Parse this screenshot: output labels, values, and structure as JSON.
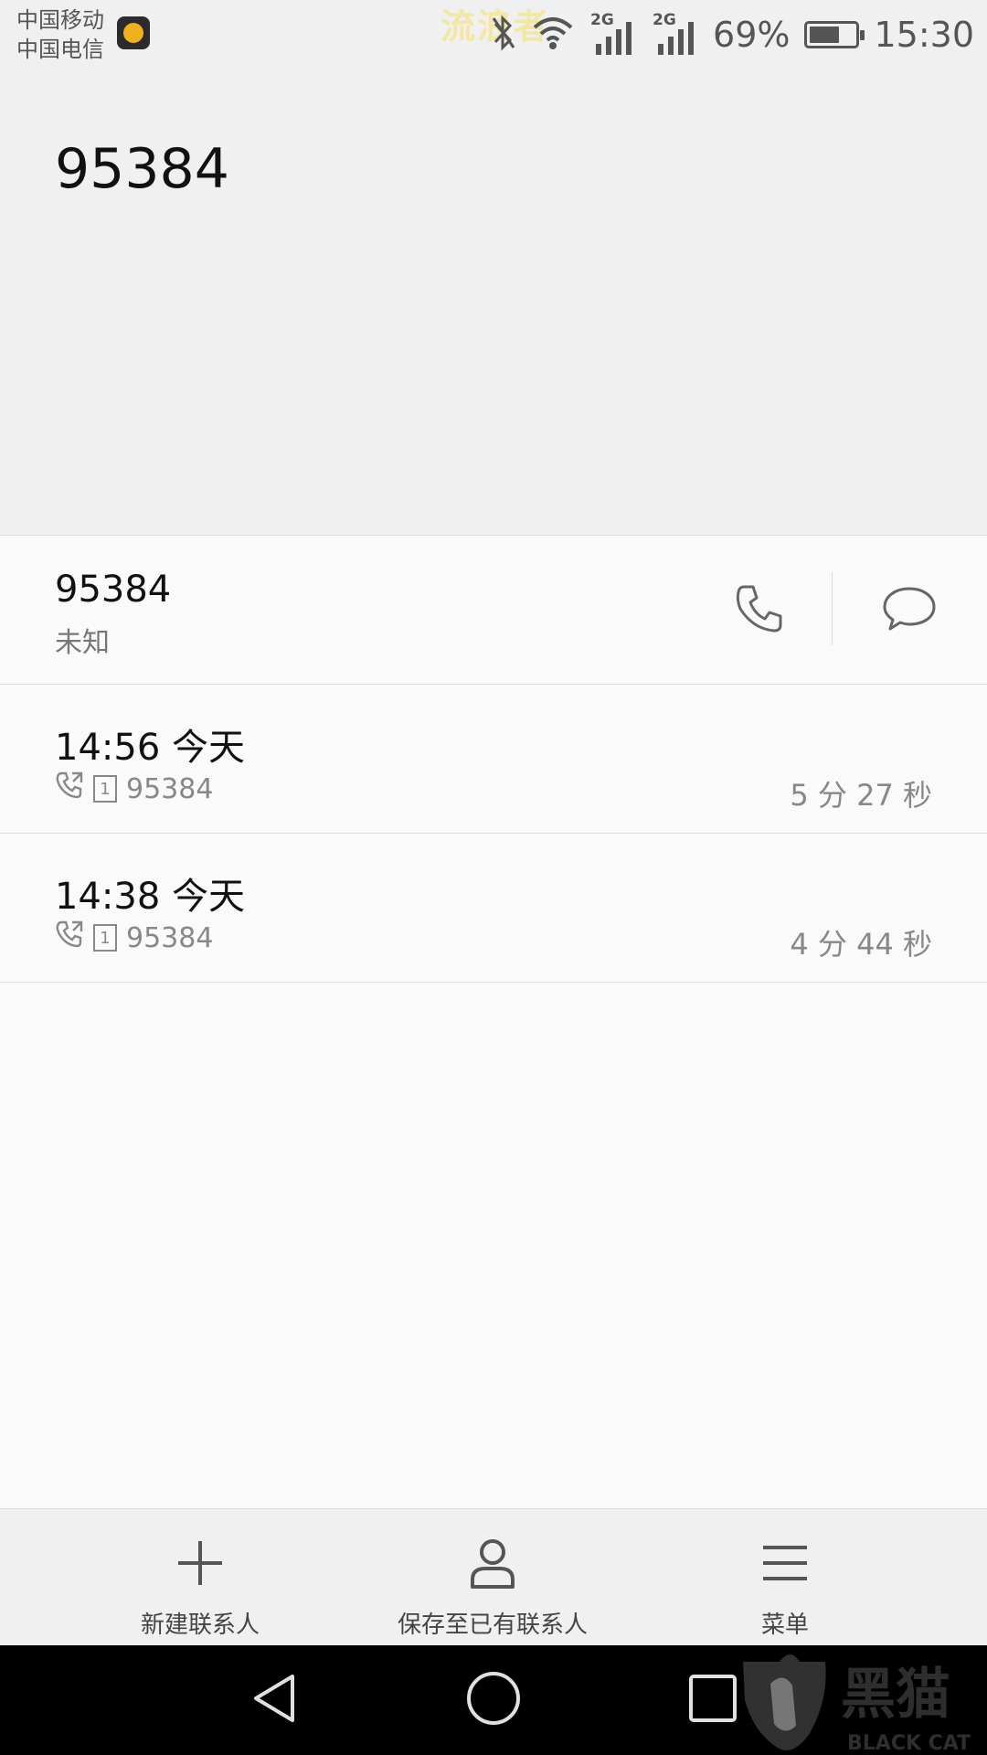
{
  "status_bar": {
    "carrier_1": "中国移动",
    "carrier_2": "中国电信",
    "watermark_text": "流浪者",
    "network_1": "2G",
    "network_2": "2G",
    "battery_percent": "69%",
    "battery_level": 0.69,
    "time": "15:30"
  },
  "header": {
    "number": "95384"
  },
  "contact": {
    "number": "95384",
    "location": "未知",
    "call_icon": "phone-icon",
    "message_icon": "message-bubble-icon"
  },
  "call_log": [
    {
      "time": "14:56 今天",
      "sim": "1",
      "number": "95384",
      "duration": "5 分 27 秒"
    },
    {
      "time": "14:38 今天",
      "sim": "1",
      "number": "95384",
      "duration": "4 分 44 秒"
    }
  ],
  "actions": {
    "new_contact": "新建联系人",
    "save_existing": "保存至已有联系人",
    "menu": "菜单"
  },
  "watermark": {
    "brand": "黑猫",
    "brand_en": "BLACK CAT"
  },
  "colors": {
    "header_bg": "#f0f0f0",
    "page_bg": "#fafafa",
    "nav_bg": "#000000"
  }
}
